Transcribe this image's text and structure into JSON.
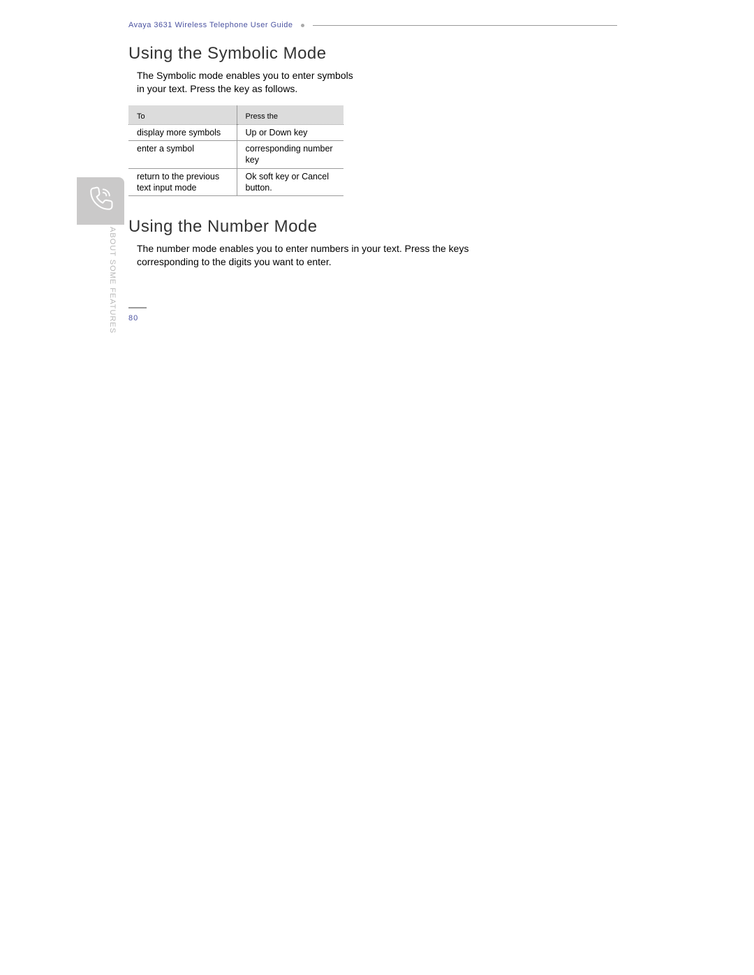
{
  "header": {
    "doc_title": "Avaya 3631 Wireless Telephone User Guide"
  },
  "section1": {
    "heading": "Using the Symbolic Mode",
    "intro": "The Symbolic mode enables you to enter symbols in your text. Press the key as follows.",
    "table": {
      "col1_header": "To",
      "col2_header": "Press the",
      "rows": [
        {
          "to": "display more symbols",
          "press": "Up or Down key"
        },
        {
          "to": "enter a symbol",
          "press": "corresponding number key"
        },
        {
          "to": "return to the previous text input mode",
          "press": "Ok soft key or Cancel button."
        }
      ]
    }
  },
  "section2": {
    "heading": "Using the Number Mode",
    "intro": "The number mode enables you to enter numbers in your text. Press the keys corresponding to the digits you want to enter."
  },
  "sidebar": {
    "vertical_label": "ABOUT SOME FEATURES"
  },
  "page_number": "80"
}
